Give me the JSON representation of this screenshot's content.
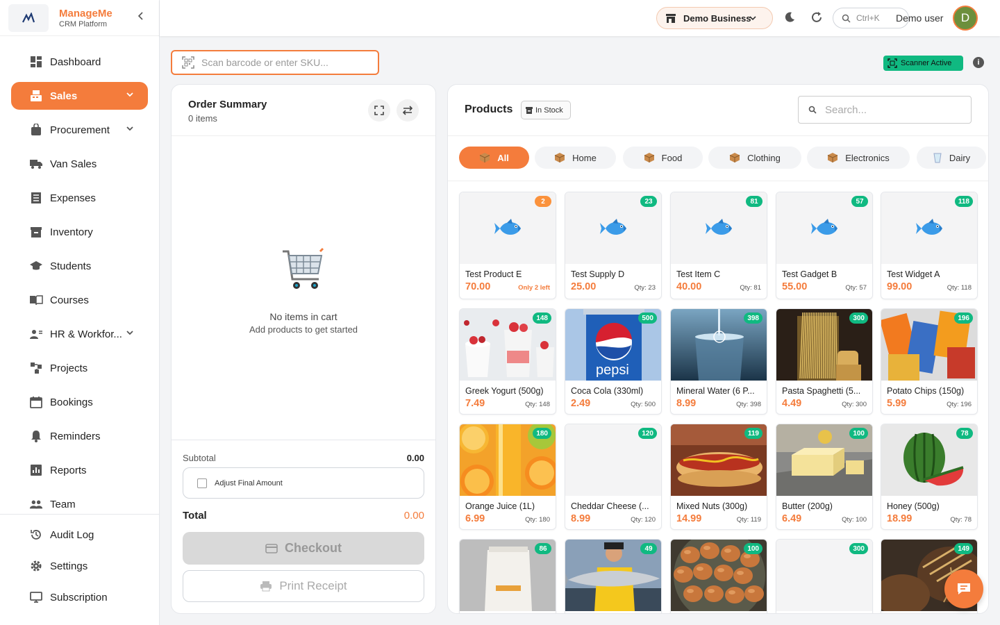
{
  "brand": {
    "name": "ManageMe",
    "subtitle": "CRM Platform"
  },
  "sidebar": {
    "items": [
      {
        "label": "Dashboard",
        "icon": "dashboard-icon"
      },
      {
        "label": "Sales",
        "icon": "register-icon",
        "active": true,
        "expandable": true
      },
      {
        "label": "Procurement",
        "icon": "bag-icon",
        "expandable": true
      },
      {
        "label": "Van Sales",
        "icon": "truck-icon"
      },
      {
        "label": "Expenses",
        "icon": "receipt-icon"
      },
      {
        "label": "Inventory",
        "icon": "archive-icon"
      },
      {
        "label": "Students",
        "icon": "graduation-cap-icon"
      },
      {
        "label": "Courses",
        "icon": "book-icon"
      },
      {
        "label": "HR & Workfor...",
        "icon": "people-icon",
        "expandable": true
      },
      {
        "label": "Projects",
        "icon": "projects-icon"
      },
      {
        "label": "Bookings",
        "icon": "calendar-icon"
      },
      {
        "label": "Reminders",
        "icon": "bell-icon"
      },
      {
        "label": "Reports",
        "icon": "chart-icon"
      },
      {
        "label": "Team",
        "icon": "team-icon"
      }
    ],
    "bottom_items": [
      {
        "label": "Audit Log",
        "icon": "history-icon"
      },
      {
        "label": "Settings",
        "icon": "gear-icon"
      },
      {
        "label": "Subscription",
        "icon": "monitor-icon"
      }
    ]
  },
  "topbar": {
    "business": "Demo Business",
    "search_shortcut": "Ctrl+K",
    "user_name": "Demo user",
    "avatar_initial": "D"
  },
  "pos": {
    "barcode_placeholder": "Scan barcode or enter SKU...",
    "scanner_status": "Scanner Active",
    "info_icon": "i"
  },
  "order": {
    "title": "Order Summary",
    "item_count": "0 items",
    "empty_title": "No items in cart",
    "empty_subtitle": "Add products to get started",
    "subtotal_label": "Subtotal",
    "subtotal_value": "0.00",
    "adjust_label": "Adjust Final Amount",
    "total_label": "Total",
    "total_value": "0.00",
    "checkout_label": "Checkout",
    "print_label": "Print Receipt"
  },
  "products": {
    "title": "Products",
    "filter_badge": "In Stock",
    "search_placeholder": "Search...",
    "categories": [
      "All",
      "Home",
      "Food",
      "Clothing",
      "Electronics",
      "Dairy"
    ],
    "items": [
      {
        "name": "Test Product E",
        "price": "70.00",
        "badge": "2",
        "qty": "Only 2 left",
        "img": "fish",
        "low": true
      },
      {
        "name": "Test Supply D",
        "price": "25.00",
        "badge": "23",
        "qty": "Qty: 23",
        "img": "fish"
      },
      {
        "name": "Test Item C",
        "price": "40.00",
        "badge": "81",
        "qty": "Qty: 81",
        "img": "fish"
      },
      {
        "name": "Test Gadget B",
        "price": "55.00",
        "badge": "57",
        "qty": "Qty: 57",
        "img": "fish"
      },
      {
        "name": "Test Widget A",
        "price": "99.00",
        "badge": "118",
        "qty": "Qty: 118",
        "img": "fish"
      },
      {
        "name": "Greek Yogurt (500g)",
        "price": "7.49",
        "badge": "148",
        "qty": "Qty: 148",
        "img": "yogurt"
      },
      {
        "name": "Coca Cola (330ml)",
        "price": "2.49",
        "badge": "500",
        "qty": "Qty: 500",
        "img": "pepsi",
        "img_text": "pepsi"
      },
      {
        "name": "Mineral Water (6 P...",
        "price": "8.99",
        "badge": "398",
        "qty": "Qty: 398",
        "img": "water"
      },
      {
        "name": "Pasta Spaghetti (5...",
        "price": "4.49",
        "badge": "300",
        "qty": "Qty: 300",
        "img": "pasta"
      },
      {
        "name": "Potato Chips (150g)",
        "price": "5.99",
        "badge": "196",
        "qty": "Qty: 196",
        "img": "chips"
      },
      {
        "name": "Orange Juice (1L)",
        "price": "6.99",
        "badge": "180",
        "qty": "Qty: 180",
        "img": "orange"
      },
      {
        "name": "Cheddar Cheese (...",
        "price": "8.99",
        "badge": "120",
        "qty": "Qty: 120",
        "img": "blank"
      },
      {
        "name": "Mixed Nuts (300g)",
        "price": "14.99",
        "badge": "119",
        "qty": "Qty: 119",
        "img": "hotdog"
      },
      {
        "name": "Butter (200g)",
        "price": "6.49",
        "badge": "100",
        "qty": "Qty: 100",
        "img": "butter"
      },
      {
        "name": "Honey (500g)",
        "price": "18.99",
        "badge": "78",
        "qty": "Qty: 78",
        "img": "melon"
      },
      {
        "name": "",
        "price": "",
        "badge": "86",
        "qty": "",
        "img": "coffee"
      },
      {
        "name": "",
        "price": "",
        "badge": "49",
        "qty": "",
        "img": "salmon"
      },
      {
        "name": "",
        "price": "",
        "badge": "100",
        "qty": "",
        "img": "eggs"
      },
      {
        "name": "",
        "price": "",
        "badge": "300",
        "qty": "",
        "img": "blank"
      },
      {
        "name": "",
        "price": "",
        "badge": "149",
        "qty": "",
        "img": "bread"
      }
    ]
  },
  "colors": {
    "accent": "#f47c3c",
    "success": "#10b981"
  }
}
